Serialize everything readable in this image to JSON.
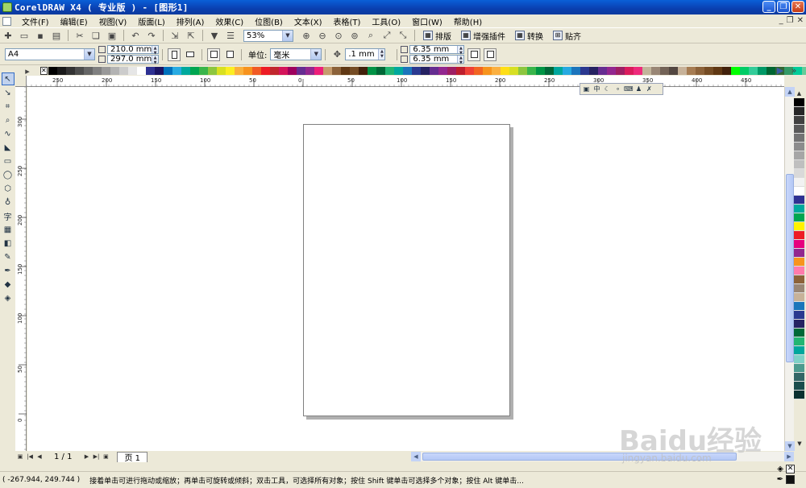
{
  "window": {
    "title": "CorelDRAW X4 ( 专业版 ) - [图形1]"
  },
  "menu": [
    "文件(F)",
    "编辑(E)",
    "视图(V)",
    "版面(L)",
    "排列(A)",
    "效果(C)",
    "位图(B)",
    "文本(X)",
    "表格(T)",
    "工具(O)",
    "窗口(W)",
    "帮助(H)"
  ],
  "toolbar": {
    "zoom": "53%",
    "buttons": {
      "imposition": "排版",
      "enhance_plugin": "增强插件",
      "convert": "转换",
      "snap": "贴齐"
    }
  },
  "property_bar": {
    "paper_size": "A4",
    "width": "210.0 mm",
    "height": "297.0 mm",
    "units_label": "单位:",
    "units": "毫米",
    "nudge": ".1 mm",
    "dup_x": "6.35 mm",
    "dup_y": "6.35 mm"
  },
  "rulers": {
    "horizontal": [
      "250",
      "200",
      "150",
      "100",
      "50",
      "0",
      "50",
      "100",
      "150",
      "200",
      "250",
      "300",
      "350",
      "400",
      "450"
    ],
    "vertical": [
      "300",
      "250",
      "200",
      "150",
      "100",
      "50",
      "0"
    ]
  },
  "page_nav": {
    "count": "1 / 1",
    "tab": "页 1"
  },
  "status": {
    "coords": "( -267.944, 249.744 )",
    "hint": "接着单击可进行拖动或缩放；再单击可旋转或倾斜；双击工具，可选择所有对象；按住 Shift 键单击可选择多个对象；按住 Alt 键单击..."
  },
  "watermark": {
    "main": "Baidu经验",
    "sub": "jingyan.baidu.com"
  },
  "palette_h": [
    "#000000",
    "#1a1a1a",
    "#333333",
    "#4d4d4d",
    "#666666",
    "#808080",
    "#999999",
    "#b3b3b3",
    "#cccccc",
    "#e6e6e6",
    "#ffffff",
    "#2e3192",
    "#1b1464",
    "#0071bc",
    "#29abe2",
    "#00a99d",
    "#00a651",
    "#39b54a",
    "#8dc63f",
    "#d9e021",
    "#fcee21",
    "#fbb03b",
    "#f7931e",
    "#f15a24",
    "#ed1c24",
    "#c1272d",
    "#d4145a",
    "#9e005d",
    "#662d91",
    "#93278f",
    "#ed1e79",
    "#c69c6d",
    "#8c6239",
    "#603813",
    "#754c24",
    "#42210b",
    "#009245",
    "#006837",
    "#22b573",
    "#00a99d",
    "#1b75bb",
    "#2b3990",
    "#262262",
    "#652d90",
    "#92278f",
    "#9e1f63",
    "#be1e2d",
    "#ef4136",
    "#f26522",
    "#f7941d",
    "#fbb040",
    "#ffde17",
    "#d7df23",
    "#8dc63f",
    "#39b54a",
    "#009444",
    "#006838",
    "#00a79d",
    "#27aae1",
    "#1c75bc",
    "#2b388f",
    "#262261",
    "#662d91",
    "#92278f",
    "#9e1f64",
    "#da1c5c",
    "#ee2a7b",
    "#c2b59b",
    "#998675",
    "#736357",
    "#534741",
    "#c7b299",
    "#a67c52",
    "#8c6239",
    "#754c24",
    "#603813",
    "#42210b",
    "#00ff00",
    "#00cc66",
    "#33cc99",
    "#009966",
    "#006633",
    "#336633",
    "#339966",
    "#00cc99",
    "#66cc99",
    "#009900"
  ],
  "palette_v": [
    "#000000",
    "#262626",
    "#404040",
    "#595959",
    "#737373",
    "#8c8c8c",
    "#a6a6a6",
    "#bfbfbf",
    "#d9d9d9",
    "#f2f2f2",
    "#ffffff",
    "#2e3192",
    "#00a99d",
    "#00a651",
    "#fff200",
    "#ed1c24",
    "#e6007e",
    "#92278f",
    "#f7941e",
    "#ff7bac",
    "#8c6239",
    "#998675",
    "#c7b299",
    "#1b75bb",
    "#2b3990",
    "#262262",
    "#006837",
    "#22b573",
    "#00a79d",
    "#7fd1c7",
    "#4d9b8f",
    "#336666",
    "#1a4d4d",
    "#0b3030"
  ]
}
